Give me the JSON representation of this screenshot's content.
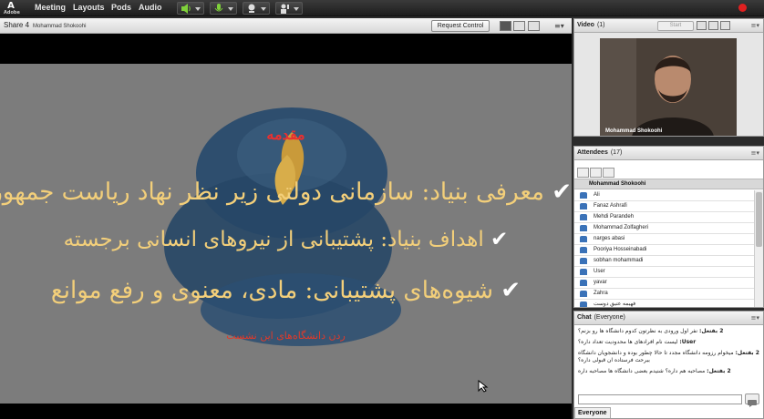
{
  "app": {
    "logo": "A",
    "logo_sub": "Adobe"
  },
  "menu": [
    "Meeting",
    "Layouts",
    "Pods",
    "Audio"
  ],
  "share": {
    "title": "Share 4",
    "presenter": "Mohammad Shokoohi",
    "request_control": "Request Control",
    "slide": {
      "heading": "مقدمه",
      "lines": [
        "معرفی بنیاد: سازمانی دولتی زیر نظر نهاد ریاست جمهوری",
        "اهداف بنیاد: پشتیبانی از نیروهای انسانی برجسته",
        "شیوه‌های پشتیبانی: مادی، معنوی و رفع موانع"
      ],
      "footer": "ردن دانشگاه‌های این نشست"
    }
  },
  "video": {
    "title": "Video",
    "count": "(1)",
    "start": "Start",
    "camera_name": "Mohammad Shokoohi"
  },
  "attendees": {
    "title": "Attendees",
    "count": "(17)",
    "host": "Mohammad Shokoohi",
    "list": [
      "Ali",
      "Fanaz Ashrafi",
      "Mehdi Parandeh",
      "Mohammad Zolfagheri",
      "narges abasi",
      "Pooriya Hosseinabadi",
      "sobhan mohammadi",
      "User",
      "yavar",
      "Zahra",
      "فهیمه عتیق دوست"
    ]
  },
  "chat": {
    "title": "Chat",
    "scope": "(Everyone)",
    "messages": [
      {
        "who": "2 بفتعل:",
        "text": "نفر اول ورودی به نظرتون کدوم دانشگاه ها رو بزنم؟"
      },
      {
        "who": "User:",
        "text": "لیست نام افرادهای ها محدودیت تعداد داره؟"
      },
      {
        "who": "2 بفتعل:",
        "text": "میخوام رزومه دانشگاه مجدد تا حالا چطور بوده و دانشجویان دانشگاه ببرحث فرستاده ان قبولی داره؟"
      },
      {
        "who": "2 بفتعل:",
        "text": "مصاحبه هم داره؟ شنیدم بعضی دانشگاه ها مصاحبه داره"
      }
    ],
    "tab": "Everyone"
  },
  "colors": {
    "accent_red": "#e02020",
    "slide_gray": "#7c7c7c",
    "gold": "#f3cf7a",
    "green": "#7fd13a"
  }
}
